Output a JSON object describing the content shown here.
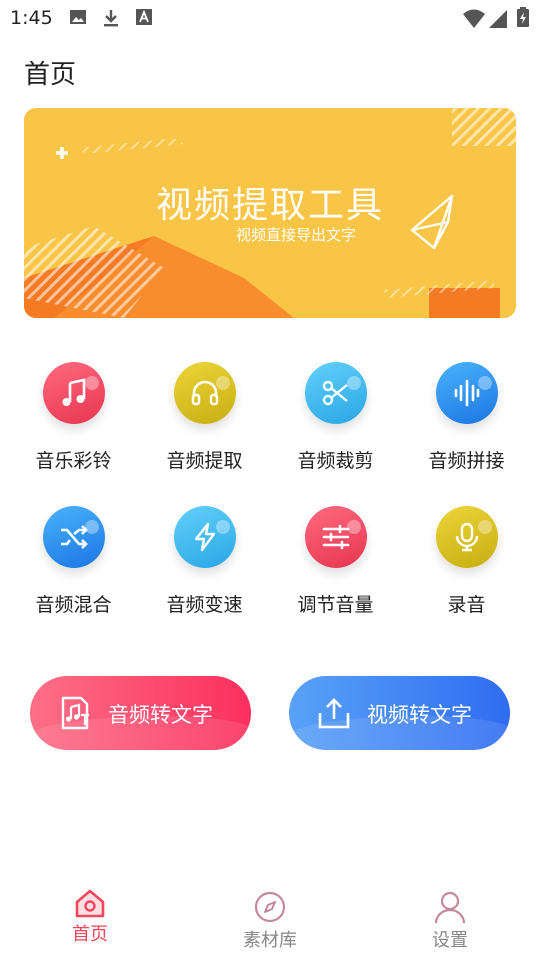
{
  "status_bar": {
    "time": "1:45",
    "left_icons": [
      "image-icon",
      "download-icon",
      "font-icon"
    ],
    "right_icons": [
      "wifi-icon",
      "signal-icon",
      "battery-icon"
    ]
  },
  "header": {
    "title": "首页"
  },
  "banner": {
    "title": "视频提取工具",
    "subtitle": "视频直接导出文字",
    "colors": {
      "bg": "#f9c547",
      "accent": "#f47a24"
    }
  },
  "features": [
    {
      "label": "音乐彩铃",
      "icon": "music-note-icon",
      "color": "#f2465c"
    },
    {
      "label": "音频提取",
      "icon": "headphones-icon",
      "color": "#d9c21d"
    },
    {
      "label": "音频裁剪",
      "icon": "scissors-icon",
      "color": "#3fb7ef"
    },
    {
      "label": "音频拼接",
      "icon": "waveform-icon",
      "color": "#2b8def"
    },
    {
      "label": "音频混合",
      "icon": "shuffle-icon",
      "color": "#2b8def"
    },
    {
      "label": "音频变速",
      "icon": "lightning-icon",
      "color": "#3fb7ef"
    },
    {
      "label": "调节音量",
      "icon": "sliders-icon",
      "color": "#f2465c"
    },
    {
      "label": "录音",
      "icon": "microphone-icon",
      "color": "#d9c21d"
    }
  ],
  "actions": {
    "audio_to_text": {
      "label": "音频转文字",
      "icon": "audio-file-icon",
      "color": "#fb3f69"
    },
    "video_to_text": {
      "label": "视频转文字",
      "icon": "upload-icon",
      "color": "#3b7cf4"
    }
  },
  "bottom_nav": [
    {
      "label": "首页",
      "icon": "home-icon",
      "active": true
    },
    {
      "label": "素材库",
      "icon": "compass-icon",
      "active": false
    },
    {
      "label": "设置",
      "icon": "user-icon",
      "active": false
    }
  ],
  "colors": {
    "active": "#f2465c",
    "inactive": "#999999"
  }
}
